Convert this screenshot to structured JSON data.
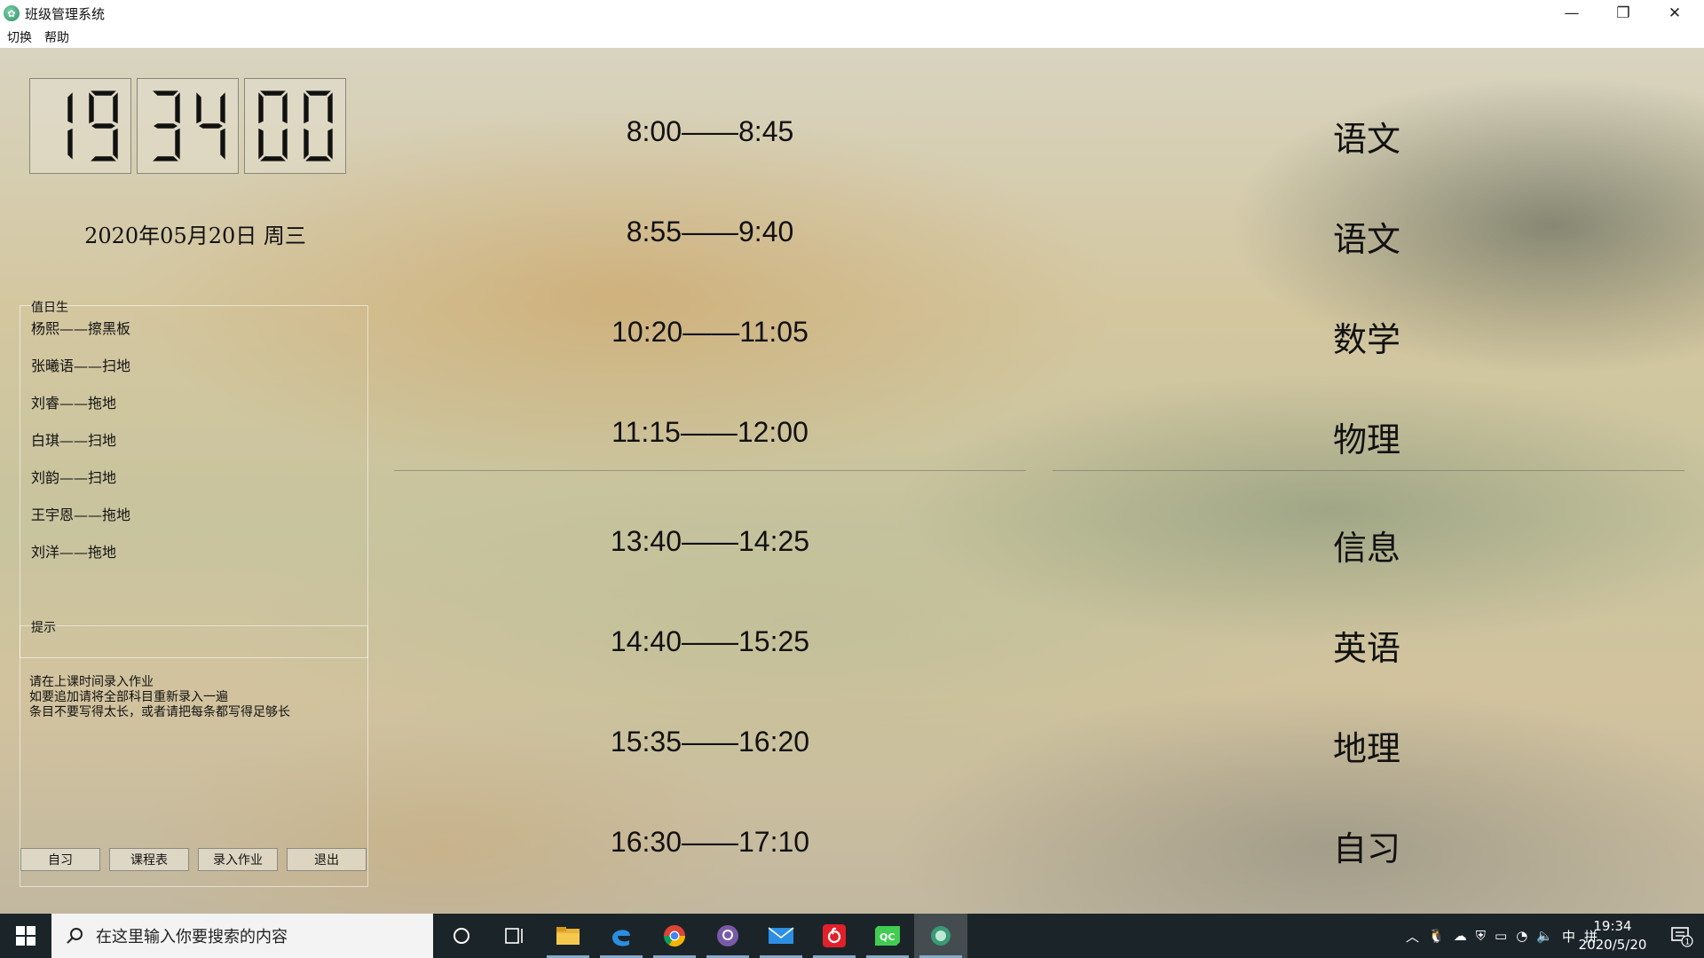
{
  "window": {
    "title": "班级管理系统",
    "controls": {
      "minimize": "—",
      "maximize": "❐",
      "close": "✕"
    }
  },
  "menu": [
    "切换",
    "帮助"
  ],
  "clock": {
    "hours": "19",
    "minutes": "34",
    "seconds": "00"
  },
  "date": "2020年05月20日  周三",
  "duty": {
    "title": "值日生",
    "items": [
      "杨熙——擦黑板",
      "张曦语——扫地",
      "刘睿——拖地",
      "白琪——扫地",
      "刘韵——扫地",
      "王宇恩——拖地",
      "刘洋——拖地"
    ]
  },
  "tips": {
    "title": "提示",
    "lines": [
      "请在上课时间录入作业",
      "如要追加请将全部科目重新录入一遍",
      "条目不要写得太长，或者请把每条都写得足够长"
    ]
  },
  "buttons": [
    "自习",
    "课程表",
    "录入作业",
    "退出"
  ],
  "schedule": [
    {
      "time": "8:00——8:45",
      "subject": "语文"
    },
    {
      "time": "8:55——9:40",
      "subject": "语文"
    },
    {
      "time": "10:20——11:05",
      "subject": "数学"
    },
    {
      "time": "11:15——12:00",
      "subject": "物理"
    },
    {
      "time": "13:40——14:25",
      "subject": "信息"
    },
    {
      "time": "14:40——15:25",
      "subject": "英语"
    },
    {
      "time": "15:35——16:20",
      "subject": "地理"
    },
    {
      "time": "16:30——17:10",
      "subject": "自习"
    }
  ],
  "taskbar": {
    "search_placeholder": "在这里输入你要搜索的内容",
    "apps": [
      "cortana",
      "task-view",
      "file-explorer",
      "edge",
      "chrome",
      "github-desktop",
      "mail",
      "netease-music",
      "qt-creator",
      "class-manager"
    ],
    "ime": "中",
    "ime_mode": "拼",
    "time": "19:34",
    "date": "2020/5/20",
    "notifications": "1"
  }
}
